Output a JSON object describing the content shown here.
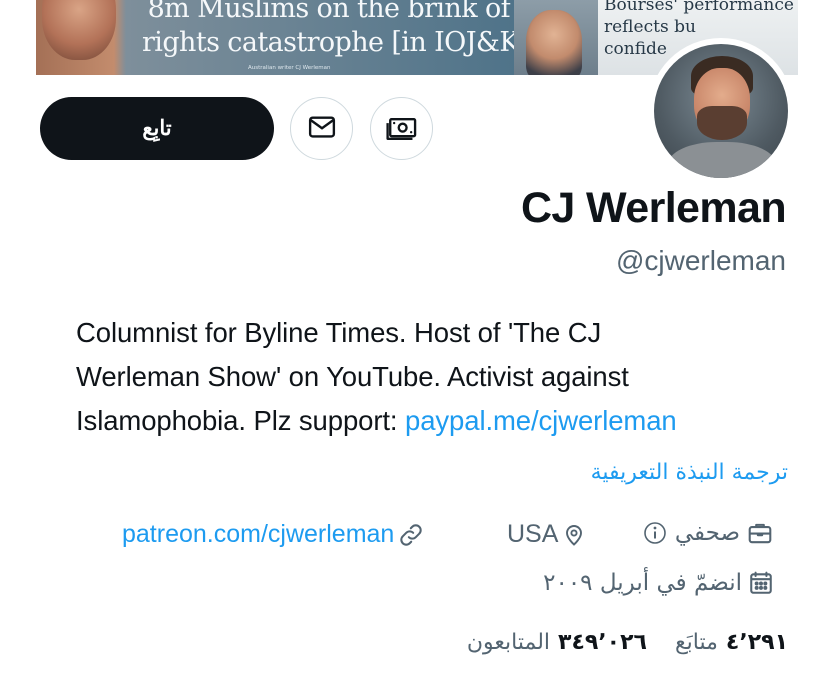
{
  "banner": {
    "headline_line1": "8m Muslims on the brink of",
    "headline_line2": "rights catastrophe [in IOJ&K]",
    "caption": "Australian writer CJ Werleman",
    "right_line1": "Bourses' performance",
    "right_line2": "reflects bu",
    "right_line3": "confide"
  },
  "actions": {
    "follow_label": "تابِع",
    "message_icon": "envelope-icon",
    "subscribe_icon": "money-icon"
  },
  "profile": {
    "display_name": "CJ Werleman",
    "handle": "@cjwerleman",
    "bio_line1": "Columnist for Byline Times. Host of 'The CJ",
    "bio_line2": "Werleman Show' on YouTube. Activist against",
    "bio_line3_text": "Islamophobia. Plz support: ",
    "bio_link": "paypal.me/cjwerleman",
    "translate_label": "ترجمة النبذة التعريفية"
  },
  "meta": {
    "job": "صحفي",
    "location": "USA",
    "url": "patreon.com/cjwerleman",
    "joined": "انضمّ في أبريل ٢٠٠٩"
  },
  "stats": {
    "following_count": "٤٬٢٩١",
    "following_label": "متابَع",
    "followers_count": "٣٤٩٬٠٢٦",
    "followers_label": "المتابعون"
  },
  "colors": {
    "accent": "#1d9bf0",
    "text": "#0f1419",
    "secondary": "#536471",
    "follow_bg": "#0f1419",
    "border": "#cfd9de"
  }
}
